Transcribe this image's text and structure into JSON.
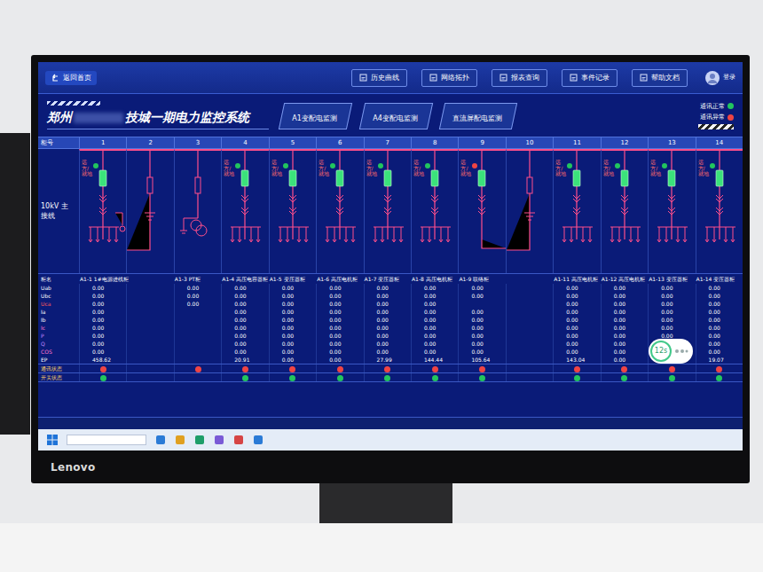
{
  "monitor": {
    "brand": "Lenovo"
  },
  "toolbar": {
    "back": "返回首页",
    "buttons": [
      {
        "label": "历史曲线"
      },
      {
        "label": "网络拓扑"
      },
      {
        "label": "报表查询"
      },
      {
        "label": "事件记录"
      },
      {
        "label": "帮助文档"
      }
    ],
    "user": "登录"
  },
  "title": {
    "prefix": "郑州",
    "suffix": "技城一期电力监控系统"
  },
  "tabs": [
    {
      "label": "A1变配电监测",
      "selected": false
    },
    {
      "label": "A4变配电监测",
      "selected": false
    },
    {
      "label": "直流屏配电监测",
      "selected": false
    }
  ],
  "legend": [
    {
      "label": "通讯正常",
      "color": "#22c55e"
    },
    {
      "label": "通讯异常",
      "color": "#ef4444"
    }
  ],
  "grid": {
    "header_label": "柜号",
    "bus_label": "10kV 主接线",
    "name_label": "柜名",
    "row_labels": [
      "Uab",
      "Ubc",
      "Uca",
      "Ia",
      "Ib",
      "Ic",
      "P",
      "Q",
      "COS",
      "EP"
    ],
    "status_labels": [
      "通讯状态",
      "开关状态"
    ]
  },
  "cabinets": [
    {
      "number": "1",
      "kind": "incoming",
      "name": "A1-1 1#电源进线柜",
      "remote": "远方/就地",
      "remote_color": "#22c55e",
      "values": [
        "0.00",
        "0.00",
        "0.00",
        "0.00",
        "0.00",
        "0.00",
        "0.00",
        "0.00",
        "0.00",
        "458.62"
      ],
      "comm_color": "#ef4444",
      "switch_color": "#22c55e"
    },
    {
      "number": "2",
      "kind": "riser",
      "name": "",
      "remote": "",
      "remote_color": "",
      "values": [
        "",
        "",
        "",
        "",
        "",
        "",
        "",
        "",
        "",
        ""
      ],
      "comm_color": "",
      "switch_color": ""
    },
    {
      "number": "3",
      "kind": "pt",
      "name": "A1-3 PT柜",
      "remote": "",
      "remote_color": "",
      "values": [
        "0.00",
        "0.00",
        "0.00",
        "",
        "",
        "",
        "",
        "",
        "",
        ""
      ],
      "comm_color": "#ef4444",
      "switch_color": ""
    },
    {
      "number": "4",
      "kind": "feeder",
      "name": "A1-4 高压电容器柜",
      "remote": "远方/就地",
      "remote_color": "#22c55e",
      "values": [
        "0.00",
        "0.00",
        "0.00",
        "0.00",
        "0.00",
        "0.00",
        "0.00",
        "0.00",
        "0.00",
        "20.91"
      ],
      "comm_color": "#ef4444",
      "switch_color": "#22c55e"
    },
    {
      "number": "5",
      "kind": "feeder",
      "name": "A1-5 变压器柜",
      "remote": "远方/就地",
      "remote_color": "#22c55e",
      "values": [
        "0.00",
        "0.00",
        "0.00",
        "0.00",
        "0.00",
        "0.00",
        "0.00",
        "0.00",
        "0.00",
        "0.00"
      ],
      "comm_color": "#ef4444",
      "switch_color": "#22c55e"
    },
    {
      "number": "6",
      "kind": "feeder",
      "name": "A1-6 高压电机柜",
      "remote": "远方/就地",
      "remote_color": "#22c55e",
      "values": [
        "0.00",
        "0.00",
        "0.00",
        "0.00",
        "0.00",
        "0.00",
        "0.00",
        "0.00",
        "0.00",
        "0.00"
      ],
      "comm_color": "#ef4444",
      "switch_color": "#22c55e"
    },
    {
      "number": "7",
      "kind": "feeder",
      "name": "A1-7 变压器柜",
      "remote": "远方/就地",
      "remote_color": "#22c55e",
      "values": [
        "0.00",
        "0.00",
        "0.00",
        "0.00",
        "0.00",
        "0.00",
        "0.00",
        "0.00",
        "0.00",
        "27.99"
      ],
      "comm_color": "#ef4444",
      "switch_color": "#22c55e"
    },
    {
      "number": "8",
      "kind": "feeder",
      "name": "A1-8 高压电机柜",
      "remote": "远方/就地",
      "remote_color": "#22c55e",
      "values": [
        "0.00",
        "0.00",
        "0.00",
        "0.00",
        "0.00",
        "0.00",
        "0.00",
        "0.00",
        "0.00",
        "144.44"
      ],
      "comm_color": "#ef4444",
      "switch_color": "#22c55e"
    },
    {
      "number": "9",
      "kind": "tie",
      "name": "A1-9 联络柜",
      "remote": "远方/就地",
      "remote_color": "#ef4444",
      "values": [
        "0.00",
        "0.00",
        "",
        "0.00",
        "0.00",
        "0.00",
        "0.00",
        "0.00",
        "0.00",
        "105.64"
      ],
      "comm_color": "#ef4444",
      "switch_color": "#22c55e"
    },
    {
      "number": "10",
      "kind": "riser",
      "name": "",
      "remote": "",
      "remote_color": "",
      "values": [
        "",
        "",
        "",
        "",
        "",
        "",
        "",
        "",
        "",
        ""
      ],
      "comm_color": "",
      "switch_color": ""
    },
    {
      "number": "11",
      "kind": "feeder",
      "name": "A1-11 高压电机柜",
      "remote": "远方/就地",
      "remote_color": "#22c55e",
      "values": [
        "0.00",
        "0.00",
        "0.00",
        "0.00",
        "0.00",
        "0.00",
        "0.00",
        "0.00",
        "0.00",
        "143.04"
      ],
      "comm_color": "#ef4444",
      "switch_color": "#22c55e"
    },
    {
      "number": "12",
      "kind": "feeder",
      "name": "A1-12 高压电机柜",
      "remote": "远方/就地",
      "remote_color": "#22c55e",
      "values": [
        "0.00",
        "0.00",
        "0.00",
        "0.00",
        "0.00",
        "0.00",
        "0.00",
        "0.00",
        "0.00",
        "0.00"
      ],
      "comm_color": "#ef4444",
      "switch_color": "#22c55e"
    },
    {
      "number": "13",
      "kind": "feeder",
      "name": "A1-13 变压器柜",
      "remote": "远方/就地",
      "remote_color": "#22c55e",
      "values": [
        "0.00",
        "0.00",
        "0.00",
        "0.00",
        "0.00",
        "0.00",
        "0.00",
        "",
        "",
        ""
      ],
      "comm_color": "#ef4444",
      "switch_color": "#22c55e"
    },
    {
      "number": "14",
      "kind": "feeder",
      "name": "A1-14 变压器柜",
      "remote": "远方/就地",
      "remote_color": "#22c55e",
      "values": [
        "0.00",
        "0.00",
        "0.00",
        "0.00",
        "0.00",
        "0.00",
        "0.00",
        "0.00",
        "0.00",
        "19.07"
      ],
      "comm_color": "#ef4444",
      "switch_color": "#22c55e"
    }
  ],
  "overlay": {
    "label": "12s"
  }
}
